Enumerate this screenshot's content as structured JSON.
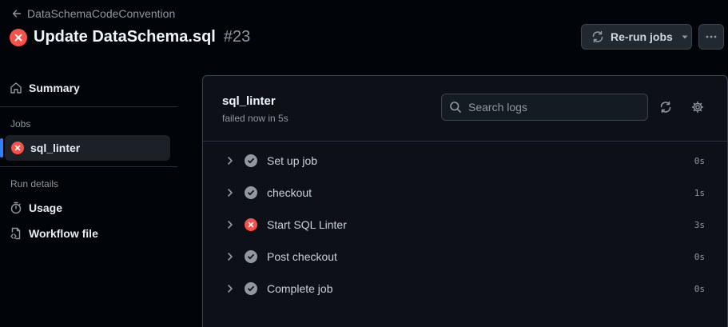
{
  "header": {
    "back_label": "DataSchemaCodeConvention",
    "title": "Update DataSchema.sql",
    "run_number": "#23",
    "rerun_label": "Re-run jobs"
  },
  "sidebar": {
    "summary_label": "Summary",
    "jobs_heading": "Jobs",
    "job_label": "sql_linter",
    "run_details_heading": "Run details",
    "usage_label": "Usage",
    "workflow_file_label": "Workflow file"
  },
  "job": {
    "name": "sql_linter",
    "status": "failed now in 5s",
    "search_placeholder": "Search logs"
  },
  "steps": [
    {
      "name": "Set up job",
      "status": "success",
      "duration": "0s"
    },
    {
      "name": "checkout",
      "status": "success",
      "duration": "1s"
    },
    {
      "name": "Start SQL Linter",
      "status": "failure",
      "duration": "3s"
    },
    {
      "name": "Post checkout",
      "status": "success",
      "duration": "0s"
    },
    {
      "name": "Complete job",
      "status": "success",
      "duration": "0s"
    }
  ],
  "colors": {
    "failure": "#f85149",
    "success_muted": "#9198a1",
    "accent": "#2f81f7",
    "background": "#010409"
  },
  "icons": {
    "back": "arrow-left-icon",
    "failure": "x-circle-icon",
    "rerun": "sync-icon",
    "more": "kebab-horizontal-icon",
    "summary": "home-icon",
    "usage": "stopwatch-icon",
    "workflow": "file-code-icon",
    "search": "search-icon",
    "refresh": "sync-icon",
    "settings": "gear-icon",
    "step_expand": "chevron-right-icon",
    "step_success": "check-circle-icon"
  }
}
